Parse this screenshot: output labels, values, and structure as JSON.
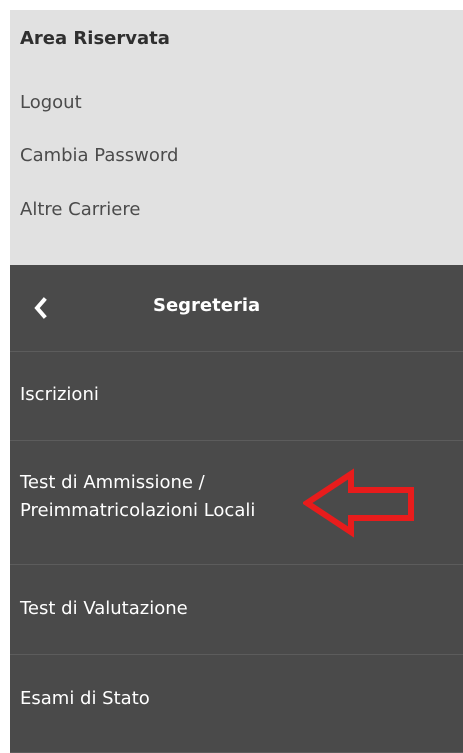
{
  "area_riservata": {
    "title": "Area Riservata",
    "links": [
      "Logout",
      "Cambia Password",
      "Altre Carriere"
    ]
  },
  "menu": {
    "back_icon": "chevron-left-icon",
    "title": "Segreteria",
    "items": [
      {
        "label": "Iscrizioni"
      },
      {
        "label": "Test di Ammissione / Preimmatricolazioni Locali"
      },
      {
        "label": "Test di Valutazione"
      },
      {
        "label": "Esami di Stato"
      }
    ]
  },
  "annotation": {
    "icon": "red-arrow-left-icon",
    "color": "#e81c1c"
  },
  "colors": {
    "top_background": "#e1e1e1",
    "menu_background": "#4a4a4a",
    "menu_text": "#ffffff"
  }
}
